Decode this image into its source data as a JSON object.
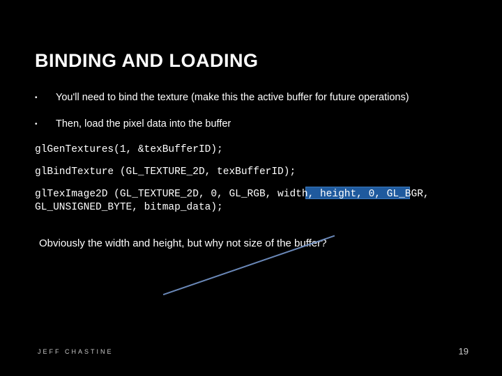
{
  "title": "BINDING AND LOADING",
  "bullets": [
    "You'll need to bind the texture (make this the active buffer for future operations)",
    "Then, load the pixel data into the buffer"
  ],
  "code": {
    "line1": "glGenTextures(1, &texBufferID);",
    "line2": "glBindTexture (GL_TEXTURE_2D, texBufferID);",
    "line3": "glTexImage2D (GL_TEXTURE_2D, 0, GL_RGB, width, height, 0, GL_BGR, GL_UNSIGNED_BYTE, bitmap_data);"
  },
  "note": "Obviously the width and height, but why not size of the buffer?",
  "footer": {
    "author": "JEFF CHASTINE",
    "page": "19"
  }
}
